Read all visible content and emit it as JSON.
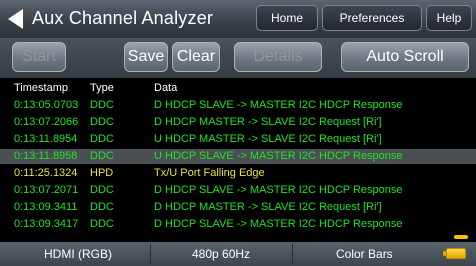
{
  "header": {
    "title": "Aux Channel Analyzer",
    "home_label": "Home",
    "preferences_label": "Preferences",
    "help_label": "Help"
  },
  "toolbar": {
    "start_label": "Start",
    "save_label": "Save",
    "clear_label": "Clear",
    "details_label": "Details",
    "autoscroll_label": "Auto Scroll"
  },
  "table": {
    "columns": [
      "Timestamp",
      "Type",
      "Data"
    ],
    "rows": [
      {
        "timestamp": "0:13:05.0703",
        "type": "DDC",
        "data": "D HDCP  SLAVE -> MASTER I2C HDCP Response"
      },
      {
        "timestamp": "0:13:07.2066",
        "type": "DDC",
        "data": "D HDCP  MASTER -> SLAVE I2C Request [Ri']"
      },
      {
        "timestamp": "0:13:11.8954",
        "type": "DDC",
        "data": "U HDCP  MASTER -> SLAVE I2C Request [Ri']"
      },
      {
        "timestamp": "0:13:11.8958",
        "type": "DDC",
        "data": "U HDCP  SLAVE -> MASTER I2C HDCP Response"
      },
      {
        "timestamp": "0:11:25.1324",
        "type": "HPD",
        "data": "Tx/U Port Falling Edge"
      },
      {
        "timestamp": "0:13:07.2071",
        "type": "DDC",
        "data": "D HDCP  SLAVE -> MASTER I2C HDCP Response"
      },
      {
        "timestamp": "0:13:09.3411",
        "type": "DDC",
        "data": "D HDCP  MASTER -> SLAVE I2C Request [Ri']"
      },
      {
        "timestamp": "0:13:09.3417",
        "type": "DDC",
        "data": "D HDCP  SLAVE -> MASTER I2C HDCP Response"
      }
    ],
    "selected_row": 3
  },
  "status": {
    "resolution": "HDMI (RGB)",
    "format": "480p 60Hz",
    "pattern": "Color Bars"
  },
  "colors": {
    "ddc_text": "#1fe324",
    "hpd_text": "#e8e33a",
    "highlight_row": "#4a4f54"
  }
}
